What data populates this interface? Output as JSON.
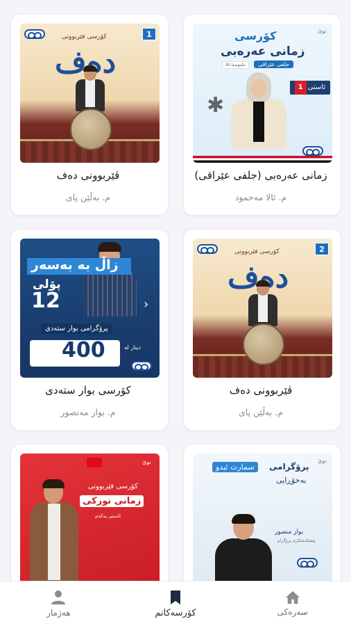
{
  "courses": [
    {
      "title": "زمانی عەرەبی (جلفی عێراقی)",
      "teacher": "م. ئالا مەحمود",
      "thumb": {
        "line1": "کۆرسی",
        "line2": "زمانی عەرەبی",
        "pill": "جلفی عێراقی",
        "pill2": "مامۆستا ئالا",
        "badge_label": "ئاستی",
        "badge_num": "1",
        "new_tag": "نوێ"
      }
    },
    {
      "title": "ڤێربوونی دەف",
      "teacher": "م. بەڵێن پای",
      "thumb": {
        "big": "دەف",
        "sub": "کۆرسی فێربوونی",
        "badge_num": "1"
      }
    },
    {
      "title": "ڤێربوونی دەف",
      "teacher": "م. بەڵێن پای",
      "thumb": {
        "big": "دەف",
        "sub": "کۆرسی فێربوونی",
        "badge_num": "2"
      }
    },
    {
      "title": "کۆرسی بوار ستەدی",
      "teacher": "م. بوار مەنصور",
      "thumb": {
        "line1": "زاڵ بە بەسەر",
        "line2": "پۆلی",
        "num": "12",
        "prog": "پرۆگرامی بوار ستەدی",
        "price": "400",
        "currency": "دینار لە"
      }
    },
    {
      "title": "",
      "teacher": "",
      "thumb": {
        "line1": "پرۆگرامی",
        "pill": "سمارت ئیدو",
        "line2": "بەخۆڕایی",
        "name": "بوار منصور",
        "sub": "پێشکەشکاری پرۆگرام",
        "new_tag": "نوێ"
      }
    },
    {
      "title": "",
      "teacher": "",
      "thumb": {
        "line1": "کۆرسی فێربوونی",
        "line2": "زمانی تورکی",
        "tag": "ئاستی یەکەم",
        "new_tag": "نوێ"
      }
    }
  ],
  "nav": {
    "home": "سەرەکی",
    "my_courses": "کۆرسەکانم",
    "account": "هەژمار"
  }
}
